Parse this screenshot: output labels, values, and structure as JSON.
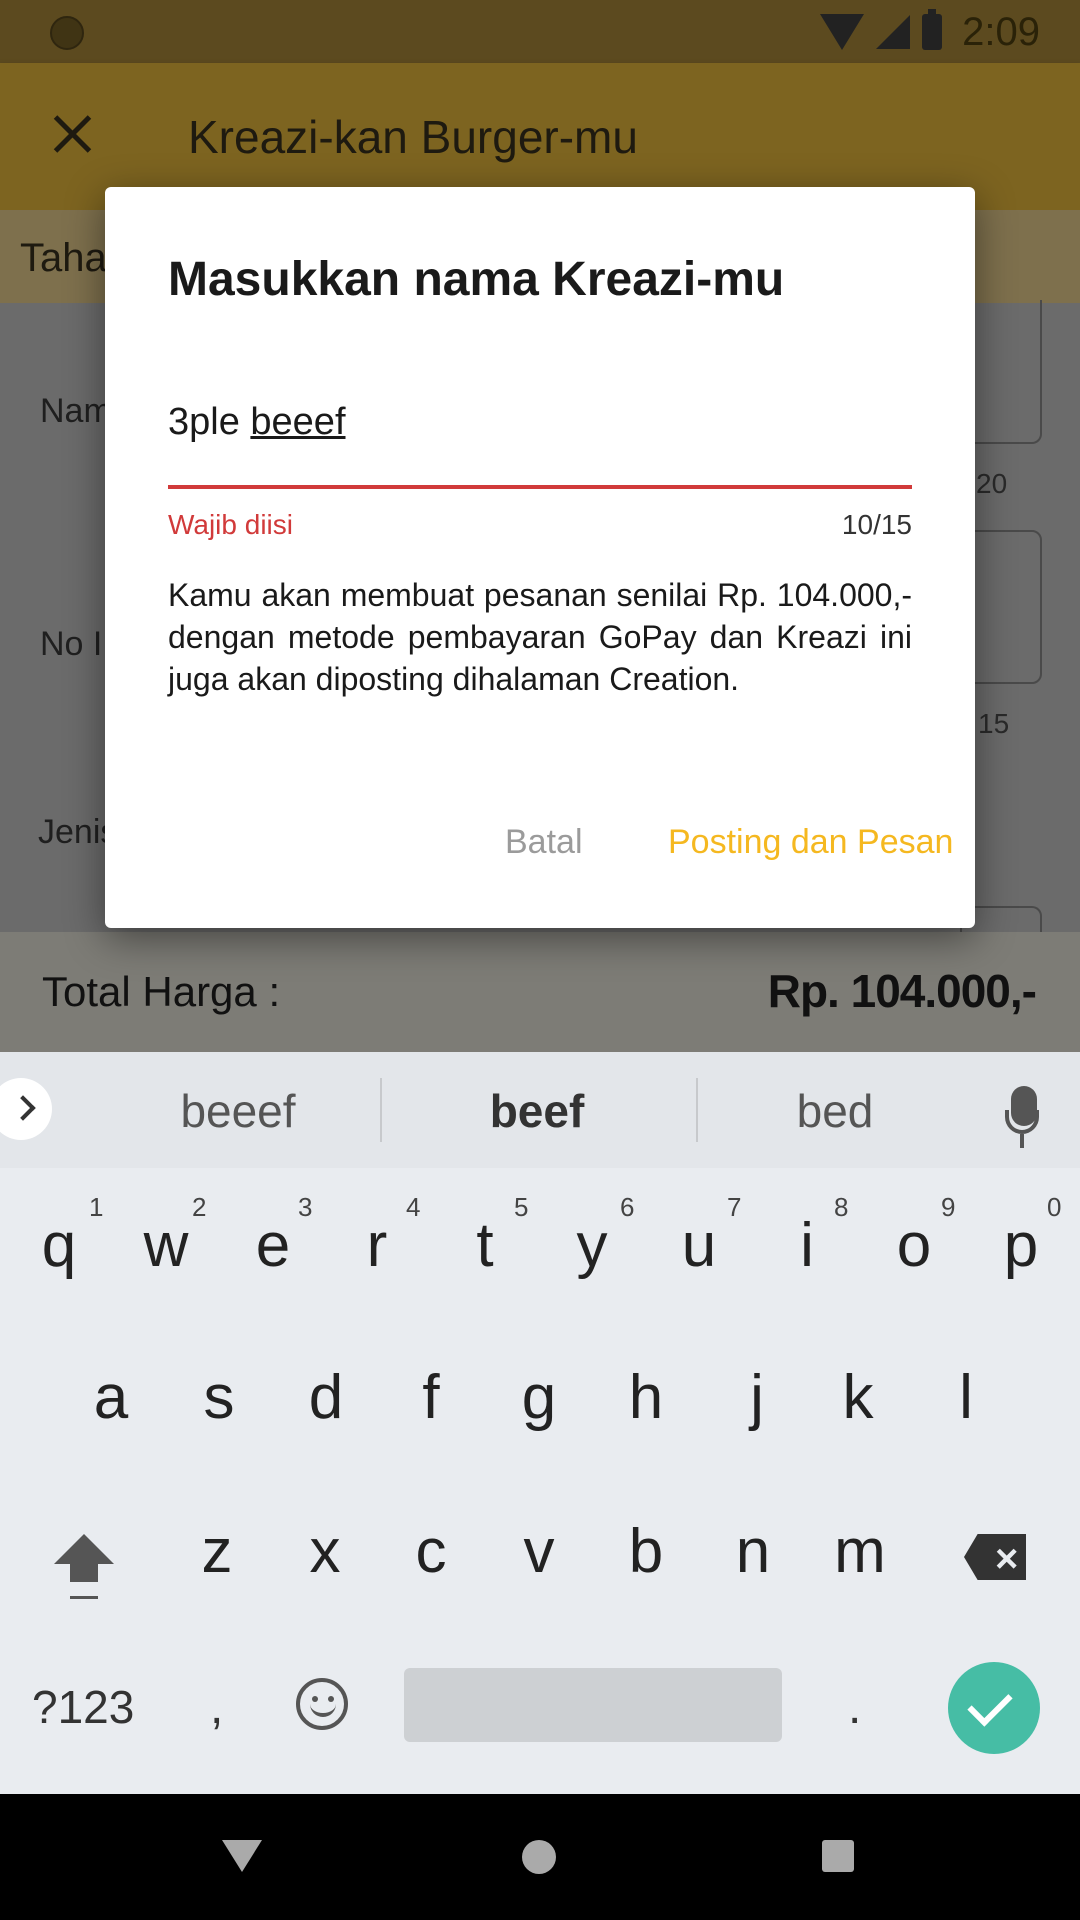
{
  "status": {
    "time": "2:09"
  },
  "toolbar": {
    "title": "Kreazi-kan Burger-mu"
  },
  "background": {
    "step_label": "Taha",
    "name_label": "Nam",
    "phone_label": "No I",
    "type_label": "Jenis",
    "counter_1": "20",
    "counter_2": "15",
    "total_label": "Total Harga :",
    "total_value": "Rp. 104.000,-"
  },
  "dialog": {
    "title": "Masukkan nama Kreazi-mu",
    "input_prefix": "3ple ",
    "input_underlined": "beeef",
    "error": "Wajib diisi",
    "counter": "10/15",
    "description": "Kamu akan membuat pesanan senilai Rp. 104.000,- dengan metode pembayaran GoPay dan Kreazi ini juga akan diposting dihalaman Creation.",
    "cancel_label": "Batal",
    "confirm_label": "Posting dan Pesan"
  },
  "keyboard": {
    "suggestions": [
      "beeef",
      "beef",
      "bed"
    ],
    "row1": [
      "q",
      "w",
      "e",
      "r",
      "t",
      "y",
      "u",
      "i",
      "o",
      "p"
    ],
    "row1_hints": [
      "1",
      "2",
      "3",
      "4",
      "5",
      "6",
      "7",
      "8",
      "9",
      "0"
    ],
    "row2": [
      "a",
      "s",
      "d",
      "f",
      "g",
      "h",
      "j",
      "k",
      "l"
    ],
    "row3": [
      "z",
      "x",
      "c",
      "v",
      "b",
      "n",
      "m"
    ],
    "symbols_label": "?123",
    "comma": ",",
    "period": "."
  }
}
